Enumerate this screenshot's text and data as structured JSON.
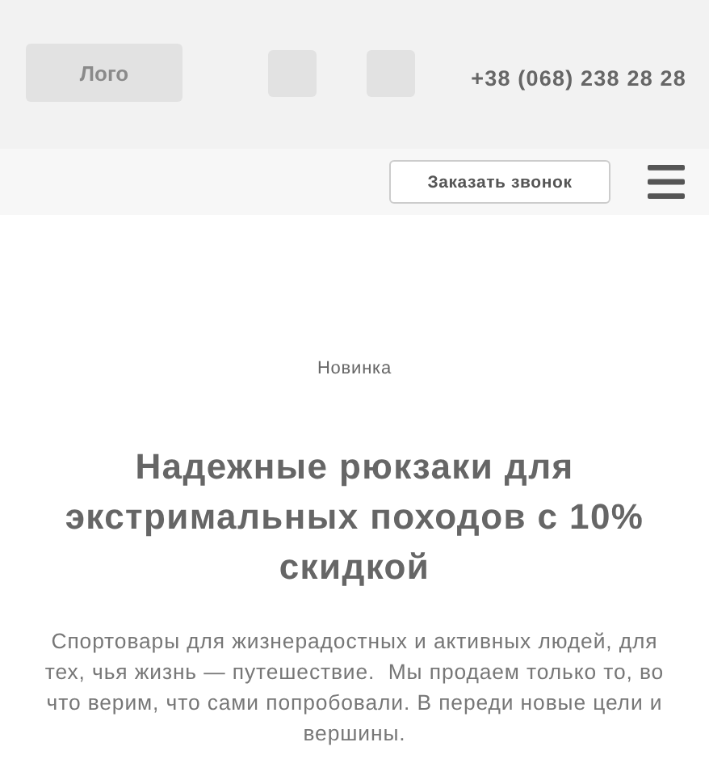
{
  "header": {
    "logo": "Лого",
    "phone": "+38 (068) 238 28 28"
  },
  "nav": {
    "callback_button": "Заказать звонок"
  },
  "hero": {
    "tag": "Новинка",
    "title": "Надежные рюкзаки для экстримальных походов с 10% скидкой",
    "description": "Спортовары для жизнерадостных и активных людей, для тех, чья жизнь — путешествие.  Мы продаем только то, во что верим, что сами попробовали. В переди новые цели и вершины."
  }
}
